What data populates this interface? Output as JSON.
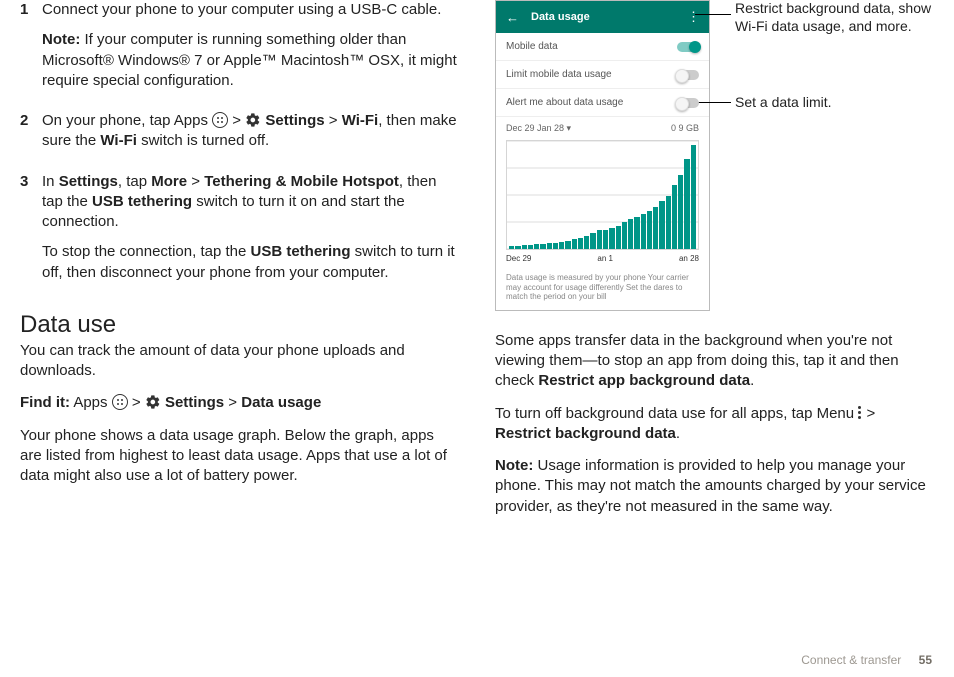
{
  "steps": [
    {
      "num": "1",
      "line1": "Connect your phone to your computer using a USB-C cable.",
      "noteLabel": "Note:",
      "noteText": " If your computer is running something older than Microsoft® Windows® 7 or Apple™ Macintosh™ OSX, it might require special configuration."
    },
    {
      "num": "2",
      "pre": "On your phone, tap Apps ",
      "sep1": " > ",
      "settings": " Settings",
      "sep2": " > ",
      "wifi": "Wi-Fi",
      "post": ", then make sure the ",
      "wifiSwitch": "Wi-Fi",
      "post2": " switch is turned off."
    },
    {
      "num": "3",
      "pre": "In ",
      "settings": "Settings",
      "mid1": ", tap ",
      "more": "More",
      "sep": " > ",
      "tether": "Tethering & Mobile Hotspot",
      "mid2": ", then tap the ",
      "usb": "USB tethering",
      "post": " switch to turn it on and start the connection.",
      "stop1": "To stop the connection, tap the ",
      "usb2": "USB tethering",
      "stop2": " switch to turn it off, then disconnect your phone from your computer."
    }
  ],
  "heading": "Data use",
  "intro": "You can track the amount of data your phone uploads and downloads.",
  "findLabel": "Find it:",
  "findApps": " Apps ",
  "findSep": " > ",
  "findSettings": " Settings",
  "findSep2": " > ",
  "findUsage": "Data usage",
  "body1": "Your phone shows a data usage graph. Below the graph, apps are listed from highest to least data usage. Apps that use a lot of data might also use a lot of battery power.",
  "right": {
    "callout1": "Restrict background data, show Wi-Fi data usage, and more.",
    "callout2": "Set a data limit.",
    "para1a": "Some apps transfer data in the background when you're not viewing them—to stop an app from doing this, tap it and then check ",
    "para1b": "Restrict app background data",
    "para1c": ".",
    "para2a": "To turn off background data use for all apps, tap Menu ",
    "para2b": " > ",
    "para2c": "Restrict background data",
    "para2d": ".",
    "noteLabel": "Note:",
    "noteText": " Usage information is provided to help you manage your phone. This may not match the amounts charged by your service provider, as they're not measured in the same way."
  },
  "phone": {
    "back": "←",
    "title": "Data usage",
    "menu": "⋮",
    "rows": {
      "r1": "Mobile data",
      "r2": "Limit mobile data usage",
      "r3": "Alert me about data usage"
    },
    "rangeLeft": "Dec 29    Jan 28  ▾",
    "rangeRight": "0 9  GB",
    "xlabels": {
      "a": "Dec 29",
      "b": "an 1",
      "c": "an 28"
    },
    "footnote": "Data usage is measured by your phone  Your carrier may account for usage differently  Set the dares to match the period on your bill"
  },
  "chart_data": {
    "type": "bar",
    "title": "Data usage",
    "xlabel": "",
    "ylabel": "",
    "ylim": [
      0,
      100
    ],
    "categories": [
      "Dec 29",
      "",
      "",
      "",
      "",
      "",
      "",
      "",
      "",
      "",
      "",
      "",
      "",
      "",
      "",
      "Jan 1",
      "",
      "",
      "",
      "",
      "",
      "",
      "",
      "",
      "",
      "",
      "",
      "",
      "",
      "Jan 28"
    ],
    "values": [
      3,
      3,
      4,
      4,
      5,
      5,
      6,
      6,
      7,
      8,
      9,
      10,
      12,
      15,
      18,
      18,
      20,
      22,
      25,
      28,
      30,
      33,
      36,
      40,
      45,
      50,
      60,
      70,
      85,
      98
    ]
  },
  "footer": {
    "section": "Connect & transfer",
    "page": "55"
  }
}
